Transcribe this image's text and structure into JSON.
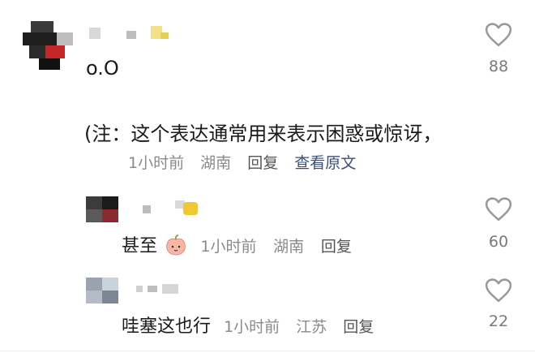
{
  "comments": [
    {
      "text": "o.O",
      "note": "(注：这个表达通常用来表示困惑或惊讶，",
      "time": "1小时前",
      "location": "湖南",
      "reply_label": "回复",
      "view_original_label": "查看原文",
      "likes": "88"
    },
    {
      "text": "甚至",
      "emoji": "peach-face-emoji",
      "time": "1小时前",
      "location": "湖南",
      "reply_label": "回复",
      "likes": "60"
    },
    {
      "text": "哇塞这也行",
      "time": "1小时前",
      "location": "江苏",
      "reply_label": "回复",
      "likes": "22"
    }
  ],
  "icons": {
    "like": "heart-outline-icon",
    "avatar": "pixelated-avatar"
  },
  "colors": {
    "text": "#1a1a1a",
    "muted": "#8a8a8a",
    "link": "#3b4f78",
    "heart": "#999999"
  }
}
